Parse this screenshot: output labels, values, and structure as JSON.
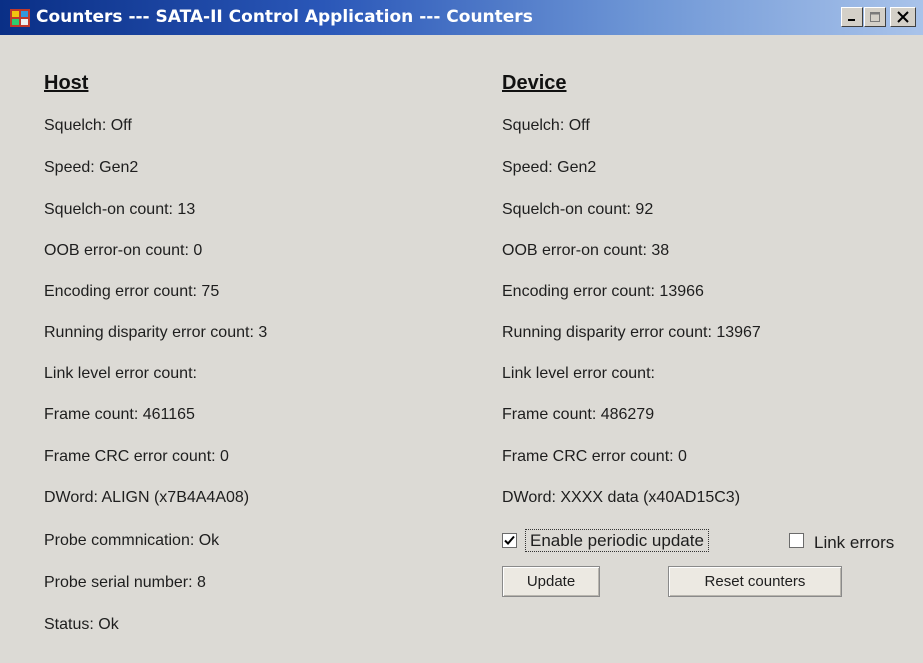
{
  "window": {
    "title": "Counters --- SATA-II Control Application --- Counters",
    "icon": "app-window-icon"
  },
  "host": {
    "heading": "Host",
    "fields": [
      "Squelch: Off",
      "Speed: Gen2",
      "Squelch-on count: 13",
      "OOB error-on count: 0",
      "Encoding error count: 75",
      "Running disparity error count: 3",
      "Link level error count:",
      "Frame count: 461165",
      "Frame CRC error count: 0",
      "DWord: ALIGN (x7B4A4A08)",
      "Probe commnication: Ok",
      "Probe serial number: 8",
      "Status: Ok"
    ]
  },
  "device": {
    "heading": "Device",
    "fields": [
      "Squelch: Off",
      "Speed: Gen2",
      "Squelch-on count: 92",
      "OOB error-on count: 38",
      "Encoding error count: 13966",
      "Running disparity error count: 13967",
      "Link level error count:",
      "Frame count: 486279",
      "Frame CRC error count: 0",
      "DWord: XXXX data (x40AD15C3)"
    ]
  },
  "controls": {
    "enable_periodic_update": {
      "label": "Enable periodic update",
      "checked": true
    },
    "link_errors": {
      "label": "Link errors",
      "checked": false
    },
    "update_button": "Update",
    "reset_button": "Reset counters"
  }
}
